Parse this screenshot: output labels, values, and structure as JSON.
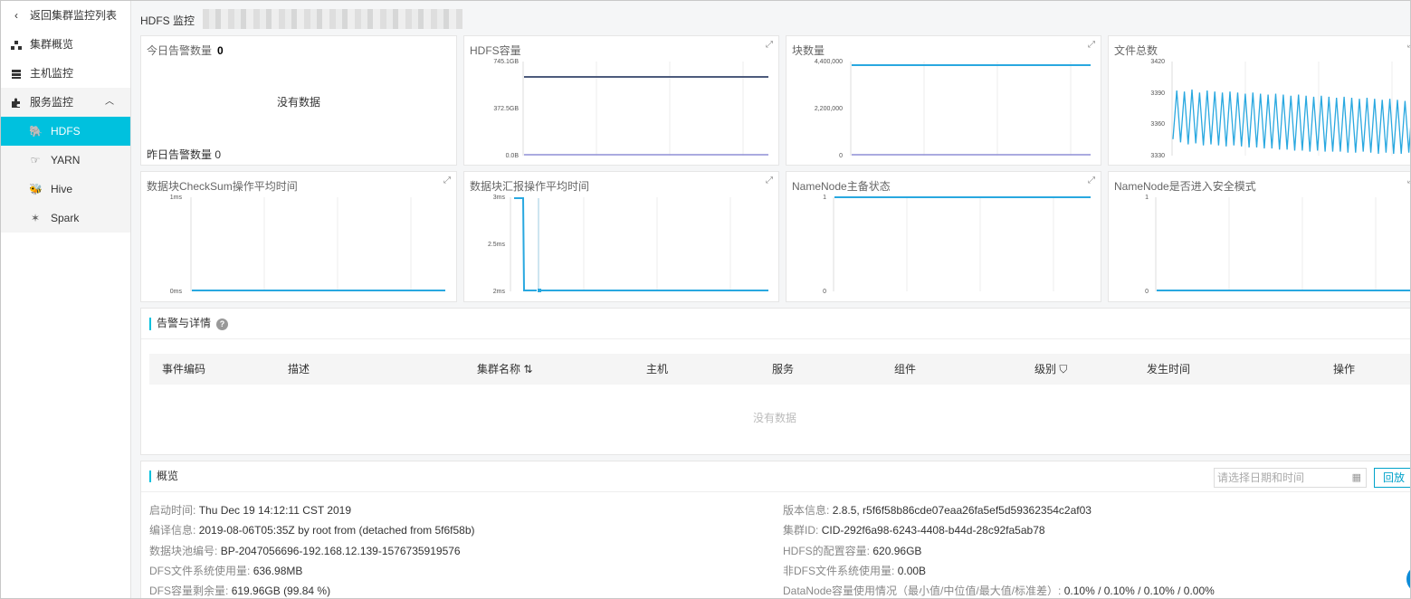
{
  "sidebar": {
    "back": {
      "icon": "chevron-left-icon",
      "label": "返回集群监控列表"
    },
    "items": [
      {
        "icon": "cluster-icon",
        "label": "集群概览"
      },
      {
        "icon": "server-icon",
        "label": "主机监控"
      }
    ],
    "group": {
      "icon": "puzzle-icon",
      "label": "服务监控",
      "children": [
        {
          "icon": "hdfs-icon",
          "label": "HDFS",
          "active": true
        },
        {
          "icon": "yarn-icon",
          "label": "YARN"
        },
        {
          "icon": "hive-icon",
          "label": "Hive"
        },
        {
          "icon": "spark-icon",
          "label": "Spark"
        }
      ]
    }
  },
  "header": {
    "title": "HDFS 监控"
  },
  "cards": {
    "alarm": {
      "today_label": "今日告警数量",
      "today_value": "0",
      "nodata": "没有数据",
      "yesterday_label": "昨日告警数量",
      "yesterday_value": "0"
    },
    "hdfs_capacity": {
      "title": "HDFS容量",
      "y_ticks": [
        "745.1GB",
        "372.5GB",
        "0.0B"
      ]
    },
    "blocks": {
      "title": "块数量",
      "y_ticks": [
        "4,400,000",
        "2,200,000",
        "0"
      ]
    },
    "files": {
      "title": "文件总数",
      "y_ticks": [
        "3420",
        "3390",
        "3360",
        "3330"
      ]
    },
    "checksum": {
      "title": "数据块CheckSum操作平均时间",
      "y_ticks": [
        "1ms",
        "0ms"
      ]
    },
    "block_report": {
      "title": "数据块汇报操作平均时间",
      "y_ticks": [
        "3ms",
        "2.5ms",
        "2ms"
      ]
    },
    "namenode_state": {
      "title": "NameNode主备状态",
      "y_ticks": [
        "1",
        "0"
      ]
    },
    "safe_mode": {
      "title": "NameNode是否进入安全模式",
      "y_ticks": [
        "1",
        "0"
      ]
    }
  },
  "chart_data": [
    {
      "type": "line",
      "title": "HDFS容量",
      "ylim": [
        0,
        745.1
      ],
      "series": [
        {
          "values": [
            620.96,
            620.96,
            620.96,
            620.96
          ]
        },
        {
          "values": [
            0,
            0,
            0,
            0
          ]
        }
      ]
    },
    {
      "type": "line",
      "title": "块数量",
      "ylim": [
        0,
        4400000
      ],
      "series": [
        {
          "values": [
            4200000,
            4200000,
            4200000,
            4200000
          ]
        },
        {
          "values": [
            0,
            0,
            0,
            0
          ]
        }
      ]
    },
    {
      "type": "line",
      "title": "文件总数",
      "ylim": [
        3330,
        3420
      ],
      "series": [
        {
          "values": [
            3345,
            3392,
            3342,
            3391,
            3340,
            3393,
            3341,
            3390,
            3339,
            3392,
            3340,
            3391,
            3339,
            3390,
            3338,
            3391,
            3339,
            3390,
            3338,
            3389,
            3337,
            3390,
            3337,
            3389,
            3336,
            3388,
            3336,
            3389,
            3335,
            3388,
            3335,
            3387,
            3334,
            3388,
            3334,
            3387,
            3333,
            3386,
            3334,
            3387,
            3333,
            3386,
            3333,
            3385,
            3333,
            3386,
            3332,
            3385,
            3332,
            3384,
            3333,
            3385,
            3332,
            3384,
            3331,
            3383,
            3332,
            3384,
            3331,
            3383,
            3331,
            3382,
            3332,
            3383,
            3331
          ]
        }
      ]
    },
    {
      "type": "line",
      "title": "数据块CheckSum操作平均时间",
      "ylim": [
        0,
        1
      ],
      "series": [
        {
          "values": [
            0,
            0,
            0,
            0
          ]
        }
      ]
    },
    {
      "type": "line",
      "title": "数据块汇报操作平均时间",
      "ylim": [
        2,
        3
      ],
      "series": [
        {
          "values": [
            3,
            3,
            2,
            2,
            2,
            2,
            2,
            2,
            2,
            2
          ]
        }
      ]
    },
    {
      "type": "line",
      "title": "NameNode主备状态",
      "ylim": [
        0,
        1
      ],
      "series": [
        {
          "values": [
            1,
            1,
            1,
            1
          ]
        }
      ]
    },
    {
      "type": "line",
      "title": "NameNode是否进入安全模式",
      "ylim": [
        0,
        1
      ],
      "series": [
        {
          "values": [
            0,
            0,
            0,
            0
          ]
        }
      ]
    }
  ],
  "alerts": {
    "title": "告警与详情",
    "columns": [
      "事件编码",
      "描述",
      "集群名称",
      "主机",
      "服务",
      "组件",
      "级别",
      "发生时间",
      "操作"
    ],
    "nodata": "没有数据"
  },
  "overview": {
    "title": "概览",
    "date_placeholder": "请选择日期和时间",
    "replay_label": "回放",
    "left": [
      {
        "k": "启动时间:",
        "v": "Thu Dec 19 14:12:11 CST 2019"
      },
      {
        "k": "编译信息:",
        "v": "2019-08-06T05:35Z by root from (detached from 5f6f58b)"
      },
      {
        "k": "数据块池编号:",
        "v": "BP-2047056696-192.168.12.139-1576735919576"
      },
      {
        "k": "DFS文件系统使用量:",
        "v": "636.98MB"
      },
      {
        "k": "DFS容量剩余量:",
        "v": "619.96GB (99.84 %)"
      }
    ],
    "right": [
      {
        "k": "版本信息:",
        "v": "2.8.5, r5f6f58b86cde07eaa26fa5ef5d59362354c2af03"
      },
      {
        "k": "集群ID:",
        "v": "CID-292f6a98-6243-4408-b44d-28c92fa5ab78"
      },
      {
        "k": "HDFS的配置容量:",
        "v": "620.96GB"
      },
      {
        "k": "非DFS文件系统使用量:",
        "v": "0.00B"
      },
      {
        "k": "DataNode容量使用情况（最小值/中位值/最大值/标准差）:",
        "v": "0.10% / 0.10% / 0.10% / 0.00%"
      }
    ]
  },
  "colors": {
    "accent": "#00c1de",
    "line": "#29a8e0",
    "dark_line": "#4d5b7c",
    "purple_line": "#8f8fd6"
  }
}
